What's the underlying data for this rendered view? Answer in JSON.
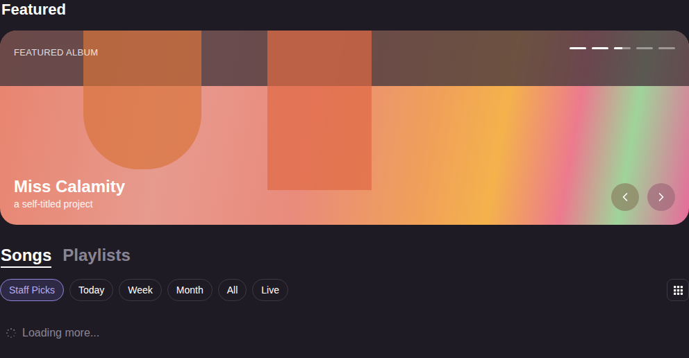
{
  "heading": "Featured",
  "featured": {
    "label": "FEATURED ALBUM",
    "title": "Miss Calamity",
    "subtitle": "a self-titled project",
    "slides": [
      {
        "level": 1
      },
      {
        "level": 1
      },
      {
        "level": 0.5
      },
      {
        "level": 0
      },
      {
        "level": 0
      }
    ]
  },
  "tabs": [
    {
      "label": "Songs",
      "selected": true
    },
    {
      "label": "Playlists",
      "selected": false
    }
  ],
  "filters": [
    {
      "label": "Staff Picks",
      "selected": true
    },
    {
      "label": "Today",
      "selected": false
    },
    {
      "label": "Week",
      "selected": false
    },
    {
      "label": "Month",
      "selected": false
    },
    {
      "label": "All",
      "selected": false
    },
    {
      "label": "Live",
      "selected": false
    }
  ],
  "loading": "Loading more..."
}
